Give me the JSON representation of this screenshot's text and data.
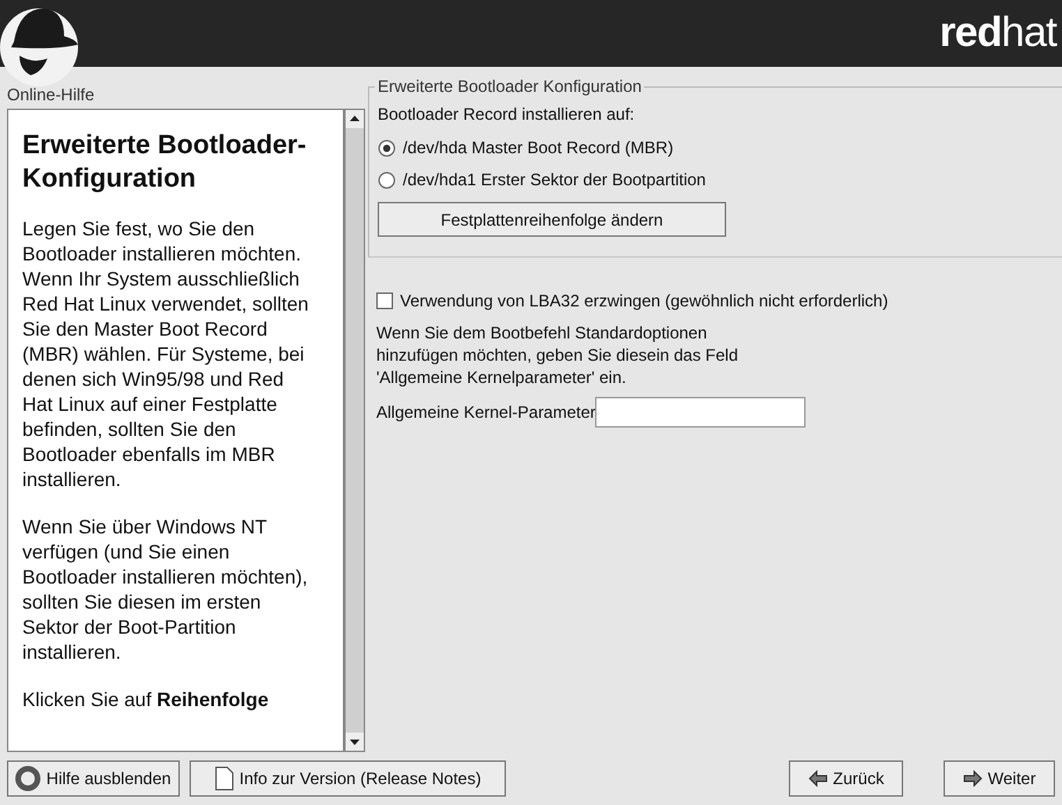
{
  "header": {
    "brand": "**red**hat"
  },
  "help": {
    "label": "Online-Hilfe",
    "heading": "Erweiterte Bootloader-Konfiguration",
    "paragraphs": [
      "Legen Sie fest, wo Sie den Bootloader installieren möchten. Wenn Ihr System ausschließlich Red Hat Linux verwendet, sollten Sie den Master Boot Record (MBR) wählen. Für Systeme, bei denen sich Win95/98 und Red Hat Linux auf einer Festplatte befinden, sollten Sie den Bootloader ebenfalls im MBR installieren.",
      "Wenn Sie über Windows NT verfügen (und Sie einen Bootloader installieren möchten), sollten Sie diesen im ersten Sektor der Boot-Partition installieren.",
      "Klicken Sie auf **Reihenfolge**"
    ]
  },
  "config": {
    "title": "Erweiterte Bootloader Konfiguration",
    "record_label": "Bootloader Record installieren auf:",
    "options": [
      {
        "label": "/dev/hda Master Boot Record (MBR)",
        "selected": true
      },
      {
        "label": "/dev/hda1 Erster Sektor der Bootpartition",
        "selected": false
      }
    ],
    "order_button": "Festplattenreihenfolge ändern",
    "lba32": {
      "label": "Verwendung von LBA32 erzwingen (gewöhnlich nicht erforderlich)",
      "checked": false
    },
    "hint": "Wenn Sie dem Bootbefehl Standardoptionen\nhinzufügen möchten, geben Sie diesein das Feld\n'Allgemeine Kernelparameter' ein.",
    "kernel_label": "Allgemeine Kernel-Parameter"
  },
  "buttons": {
    "hide_help": "Hilfe ausblenden",
    "release_notes": "Info zur Version (Release Notes)",
    "back": "Zurück",
    "next": "Weiter"
  }
}
